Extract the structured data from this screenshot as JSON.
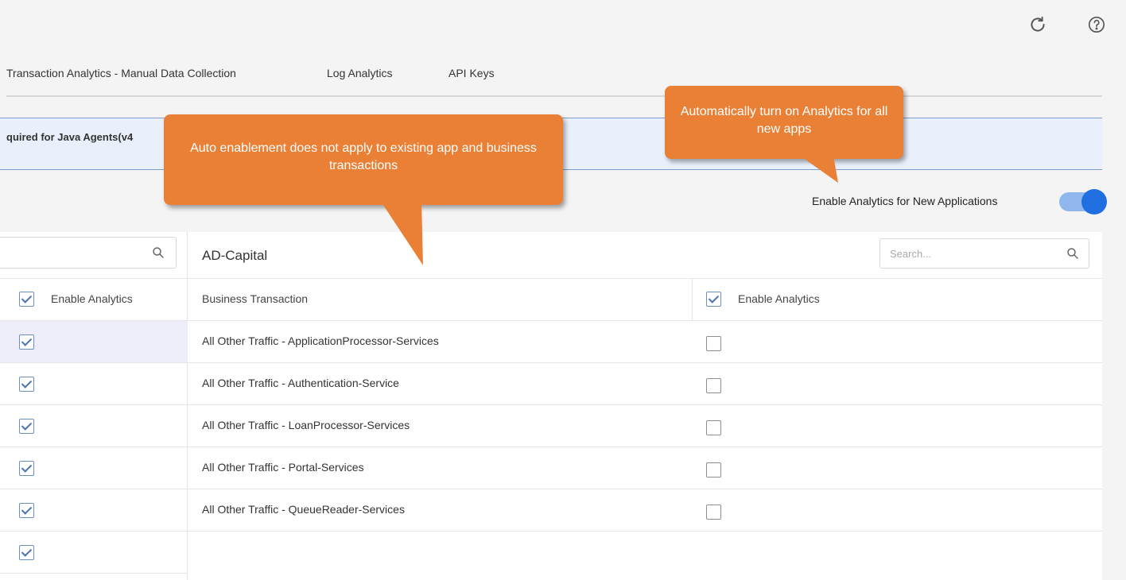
{
  "top_icons": {
    "refresh": "refresh-icon",
    "help": "help-icon"
  },
  "tabs": [
    "Transaction Analytics - Manual Data Collection",
    "Log Analytics",
    "API Keys"
  ],
  "banner": {
    "text": "quired for Java Agents(v4"
  },
  "toggle": {
    "label": "Enable Analytics for New Applications",
    "state": "on",
    "accent": "#1f6fe0"
  },
  "left_panel": {
    "header_label": "Enable Analytics",
    "header_checked": true,
    "rows_checked": [
      true,
      true,
      true,
      true,
      true,
      true
    ]
  },
  "main_panel": {
    "title": "AD-Capital",
    "search_placeholder": "Search...",
    "col_bt": "Business Transaction",
    "col_enable": "Enable Analytics",
    "header_checked": true,
    "rows": [
      {
        "name": "All Other Traffic - ApplicationProcessor-Services",
        "enabled": false
      },
      {
        "name": "All Other Traffic - Authentication-Service",
        "enabled": false
      },
      {
        "name": "All Other Traffic - LoanProcessor-Services",
        "enabled": false
      },
      {
        "name": "All Other Traffic - Portal-Services",
        "enabled": false
      },
      {
        "name": "All Other Traffic - QueueReader-Services",
        "enabled": false
      }
    ]
  },
  "callouts": {
    "existing": "Auto enablement does not apply to existing app and business transactions",
    "new_apps": "Automatically turn on Analytics for all new apps",
    "color": "#ea8036"
  }
}
